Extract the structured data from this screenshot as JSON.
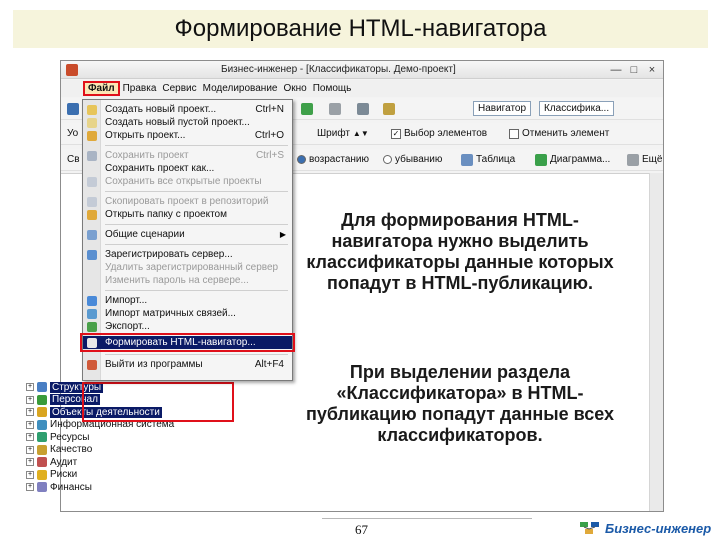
{
  "slide": {
    "title": "Формирование HTML-навигатора",
    "page_number": "67",
    "brand": "Бизнес-инженер",
    "brand_color": "#1b5aa8"
  },
  "window": {
    "title": "Бизнес-инженер - [Классификаторы. Демо-проект]",
    "controls": [
      "—",
      "□",
      "×"
    ]
  },
  "menu_bar": {
    "items": [
      "Файл",
      "Правка",
      "Сервис",
      "Моделирование",
      "Окно",
      "Помощь"
    ]
  },
  "toolbar": {
    "row1_tabs": [
      "Навигатор",
      "Классифика..."
    ],
    "row2": {
      "label_left": "Уо",
      "font_label": "Шрифт",
      "checkbox_select_elements": "Выбор элементов",
      "checkbox_deselect": "Отменить элемент"
    },
    "row3": {
      "label_left": "Св",
      "radio_ascending": "возрастанию",
      "radio_descending": "убыванию",
      "table_button": "Таблица",
      "diagram_button": "Диаграмма...",
      "more_button": "Ещё"
    }
  },
  "file_menu": {
    "items": [
      {
        "label": "Создать новый проект...",
        "shortcut": "Ctrl+N",
        "enabled": true,
        "icon": "new-project-icon"
      },
      {
        "label": "Создать новый пустой проект...",
        "shortcut": "",
        "enabled": true,
        "icon": "new-empty-project-icon"
      },
      {
        "label": "Открыть проект...",
        "shortcut": "Ctrl+O",
        "enabled": true,
        "icon": "open-folder-icon"
      },
      {
        "label": "Сохранить проект",
        "shortcut": "Ctrl+S",
        "enabled": false,
        "icon": "save-icon"
      },
      {
        "label": "Сохранить проект как...",
        "shortcut": "",
        "enabled": true,
        "icon": ""
      },
      {
        "label": "Сохранить все открытые проекты",
        "shortcut": "",
        "enabled": false,
        "icon": "save-all-icon"
      },
      {
        "label": "Скопировать проект в репозиторий",
        "shortcut": "",
        "enabled": false,
        "icon": "copy-to-repo-icon"
      },
      {
        "label": "Открыть папку с проектом",
        "shortcut": "",
        "enabled": true,
        "icon": "folder-icon"
      },
      {
        "label": "Общие сценарии",
        "shortcut": "",
        "enabled": true,
        "icon": "scripts-icon",
        "submenu": true
      },
      {
        "label": "Зарегистрировать сервер...",
        "shortcut": "",
        "enabled": true,
        "icon": "server-icon"
      },
      {
        "label": "Удалить зарегистрированный сервер",
        "shortcut": "",
        "enabled": false,
        "icon": ""
      },
      {
        "label": "Изменить пароль на сервере...",
        "shortcut": "",
        "enabled": false,
        "icon": ""
      },
      {
        "label": "Импорт...",
        "shortcut": "",
        "enabled": true,
        "icon": "import-icon"
      },
      {
        "label": "Импорт матричных связей...",
        "shortcut": "",
        "enabled": true,
        "icon": "matrix-import-icon"
      },
      {
        "label": "Экспорт...",
        "shortcut": "",
        "enabled": true,
        "icon": "export-icon"
      },
      {
        "label": "Формировать HTML-навигатор...",
        "shortcut": "",
        "enabled": true,
        "icon": "html-navigator-icon",
        "active": true
      },
      {
        "label": "Выйти из программы",
        "shortcut": "Alt+F4",
        "enabled": true,
        "icon": "exit-icon"
      }
    ]
  },
  "tree": {
    "items": [
      {
        "label": "Структуры",
        "selected": true,
        "icon_color": "#4a7fc4"
      },
      {
        "label": "Персонал",
        "selected": true,
        "icon_color": "#3a9b3a"
      },
      {
        "label": "Объекты деятельности",
        "selected": true,
        "icon_color": "#d9a520"
      },
      {
        "label": "Информационная система",
        "selected": false,
        "icon_color": "#3f8fbf"
      },
      {
        "label": "Ресурсы",
        "selected": false,
        "icon_color": "#2f9f6f"
      },
      {
        "label": "Качество",
        "selected": false,
        "icon_color": "#c8a030"
      },
      {
        "label": "Аудит",
        "selected": false,
        "icon_color": "#c05050"
      },
      {
        "label": "Риски",
        "selected": false,
        "icon_color": "#e0b020"
      },
      {
        "label": "Финансы",
        "selected": false,
        "icon_color": "#8080c0"
      }
    ]
  },
  "explanation": {
    "paragraph1": "Для формирования HTML-навигатора нужно выделить классификаторы данные которых попадут в HTML-публикацию.",
    "paragraph2": "При выделении раздела «Классификатора» в HTML-публикацию попадут данные всех классификаторов."
  },
  "colors": {
    "highlight": "#e0101a",
    "selection": "#0a1a66",
    "title_bg": "#f6f4dc"
  }
}
